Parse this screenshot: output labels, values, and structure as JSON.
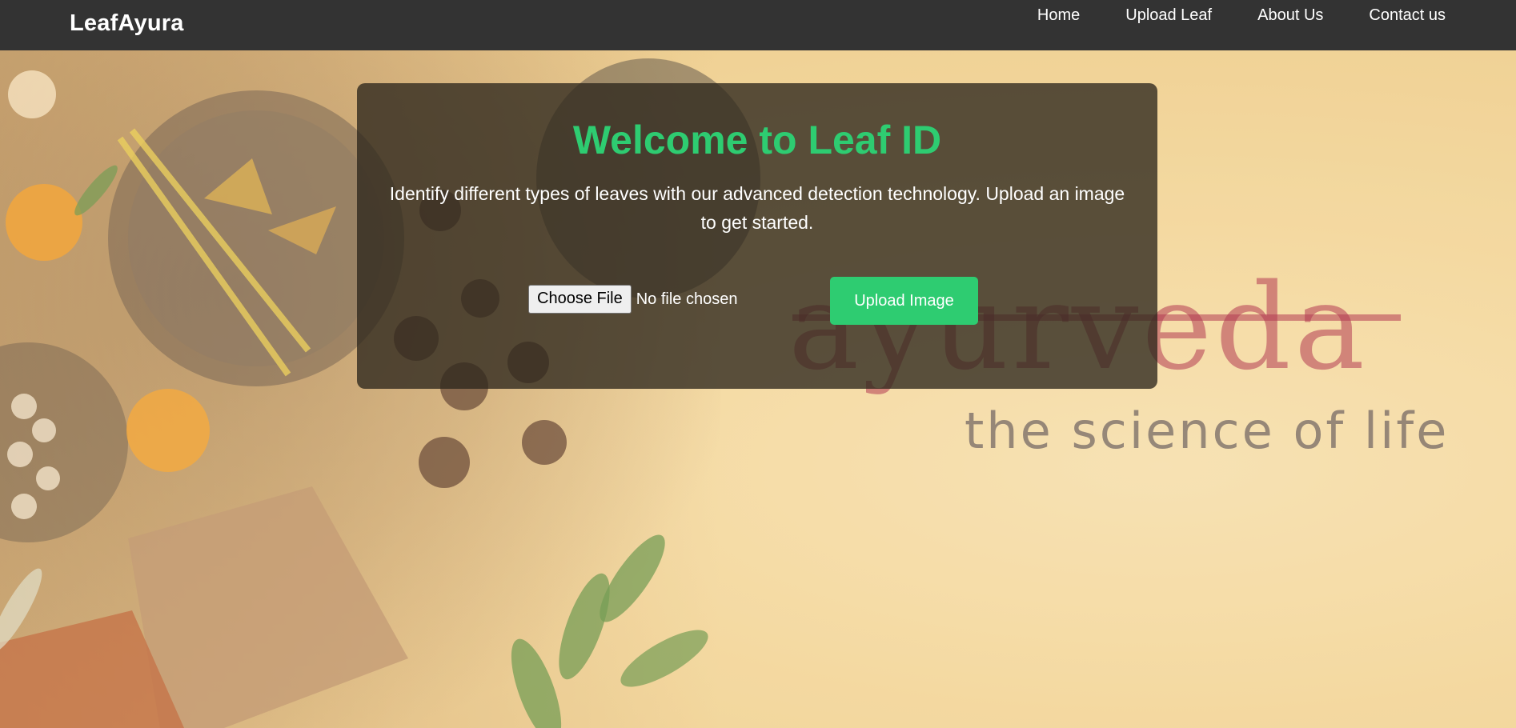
{
  "navbar": {
    "brand": "LeafAyura",
    "links": [
      {
        "label": "Home"
      },
      {
        "label": "Upload Leaf"
      },
      {
        "label": "About Us"
      },
      {
        "label": "Contact us"
      }
    ]
  },
  "hero": {
    "title": "Welcome to Leaf ID",
    "description": "Identify different types of leaves with our advanced detection technology. Upload an image to get started.",
    "file_input": {
      "button_label": "Choose File",
      "status_text": "No file chosen"
    },
    "upload_button_label": "Upload Image"
  },
  "background": {
    "logo_title": "ayurveda",
    "logo_subtitle": "the science of life"
  },
  "colors": {
    "navbar": "#333333",
    "accent_green": "#2ecc71",
    "card_bg": "#2d261c"
  },
  "icons": {
    "background_image": "ayurveda-herbs-image"
  }
}
